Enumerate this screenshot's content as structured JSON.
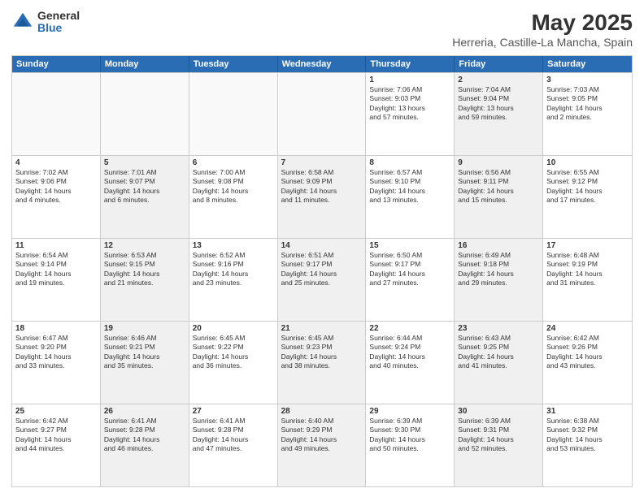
{
  "logo": {
    "general": "General",
    "blue": "Blue"
  },
  "title": "May 2025",
  "subtitle": "Herreria, Castille-La Mancha, Spain",
  "header": {
    "days": [
      "Sunday",
      "Monday",
      "Tuesday",
      "Wednesday",
      "Thursday",
      "Friday",
      "Saturday"
    ]
  },
  "rows": [
    [
      {
        "day": "",
        "info": "",
        "shaded": true
      },
      {
        "day": "",
        "info": "",
        "shaded": true
      },
      {
        "day": "",
        "info": "",
        "shaded": true
      },
      {
        "day": "",
        "info": "",
        "shaded": true
      },
      {
        "day": "1",
        "info": "Sunrise: 7:06 AM\nSunset: 9:03 PM\nDaylight: 13 hours\nand 57 minutes.",
        "shaded": false
      },
      {
        "day": "2",
        "info": "Sunrise: 7:04 AM\nSunset: 9:04 PM\nDaylight: 13 hours\nand 59 minutes.",
        "shaded": true
      },
      {
        "day": "3",
        "info": "Sunrise: 7:03 AM\nSunset: 9:05 PM\nDaylight: 14 hours\nand 2 minutes.",
        "shaded": false
      }
    ],
    [
      {
        "day": "4",
        "info": "Sunrise: 7:02 AM\nSunset: 9:06 PM\nDaylight: 14 hours\nand 4 minutes.",
        "shaded": false
      },
      {
        "day": "5",
        "info": "Sunrise: 7:01 AM\nSunset: 9:07 PM\nDaylight: 14 hours\nand 6 minutes.",
        "shaded": true
      },
      {
        "day": "6",
        "info": "Sunrise: 7:00 AM\nSunset: 9:08 PM\nDaylight: 14 hours\nand 8 minutes.",
        "shaded": false
      },
      {
        "day": "7",
        "info": "Sunrise: 6:58 AM\nSunset: 9:09 PM\nDaylight: 14 hours\nand 11 minutes.",
        "shaded": true
      },
      {
        "day": "8",
        "info": "Sunrise: 6:57 AM\nSunset: 9:10 PM\nDaylight: 14 hours\nand 13 minutes.",
        "shaded": false
      },
      {
        "day": "9",
        "info": "Sunrise: 6:56 AM\nSunset: 9:11 PM\nDaylight: 14 hours\nand 15 minutes.",
        "shaded": true
      },
      {
        "day": "10",
        "info": "Sunrise: 6:55 AM\nSunset: 9:12 PM\nDaylight: 14 hours\nand 17 minutes.",
        "shaded": false
      }
    ],
    [
      {
        "day": "11",
        "info": "Sunrise: 6:54 AM\nSunset: 9:14 PM\nDaylight: 14 hours\nand 19 minutes.",
        "shaded": false
      },
      {
        "day": "12",
        "info": "Sunrise: 6:53 AM\nSunset: 9:15 PM\nDaylight: 14 hours\nand 21 minutes.",
        "shaded": true
      },
      {
        "day": "13",
        "info": "Sunrise: 6:52 AM\nSunset: 9:16 PM\nDaylight: 14 hours\nand 23 minutes.",
        "shaded": false
      },
      {
        "day": "14",
        "info": "Sunrise: 6:51 AM\nSunset: 9:17 PM\nDaylight: 14 hours\nand 25 minutes.",
        "shaded": true
      },
      {
        "day": "15",
        "info": "Sunrise: 6:50 AM\nSunset: 9:17 PM\nDaylight: 14 hours\nand 27 minutes.",
        "shaded": false
      },
      {
        "day": "16",
        "info": "Sunrise: 6:49 AM\nSunset: 9:18 PM\nDaylight: 14 hours\nand 29 minutes.",
        "shaded": true
      },
      {
        "day": "17",
        "info": "Sunrise: 6:48 AM\nSunset: 9:19 PM\nDaylight: 14 hours\nand 31 minutes.",
        "shaded": false
      }
    ],
    [
      {
        "day": "18",
        "info": "Sunrise: 6:47 AM\nSunset: 9:20 PM\nDaylight: 14 hours\nand 33 minutes.",
        "shaded": false
      },
      {
        "day": "19",
        "info": "Sunrise: 6:46 AM\nSunset: 9:21 PM\nDaylight: 14 hours\nand 35 minutes.",
        "shaded": true
      },
      {
        "day": "20",
        "info": "Sunrise: 6:45 AM\nSunset: 9:22 PM\nDaylight: 14 hours\nand 36 minutes.",
        "shaded": false
      },
      {
        "day": "21",
        "info": "Sunrise: 6:45 AM\nSunset: 9:23 PM\nDaylight: 14 hours\nand 38 minutes.",
        "shaded": true
      },
      {
        "day": "22",
        "info": "Sunrise: 6:44 AM\nSunset: 9:24 PM\nDaylight: 14 hours\nand 40 minutes.",
        "shaded": false
      },
      {
        "day": "23",
        "info": "Sunrise: 6:43 AM\nSunset: 9:25 PM\nDaylight: 14 hours\nand 41 minutes.",
        "shaded": true
      },
      {
        "day": "24",
        "info": "Sunrise: 6:42 AM\nSunset: 9:26 PM\nDaylight: 14 hours\nand 43 minutes.",
        "shaded": false
      }
    ],
    [
      {
        "day": "25",
        "info": "Sunrise: 6:42 AM\nSunset: 9:27 PM\nDaylight: 14 hours\nand 44 minutes.",
        "shaded": false
      },
      {
        "day": "26",
        "info": "Sunrise: 6:41 AM\nSunset: 9:28 PM\nDaylight: 14 hours\nand 46 minutes.",
        "shaded": true
      },
      {
        "day": "27",
        "info": "Sunrise: 6:41 AM\nSunset: 9:28 PM\nDaylight: 14 hours\nand 47 minutes.",
        "shaded": false
      },
      {
        "day": "28",
        "info": "Sunrise: 6:40 AM\nSunset: 9:29 PM\nDaylight: 14 hours\nand 49 minutes.",
        "shaded": true
      },
      {
        "day": "29",
        "info": "Sunrise: 6:39 AM\nSunset: 9:30 PM\nDaylight: 14 hours\nand 50 minutes.",
        "shaded": false
      },
      {
        "day": "30",
        "info": "Sunrise: 6:39 AM\nSunset: 9:31 PM\nDaylight: 14 hours\nand 52 minutes.",
        "shaded": true
      },
      {
        "day": "31",
        "info": "Sunrise: 6:38 AM\nSunset: 9:32 PM\nDaylight: 14 hours\nand 53 minutes.",
        "shaded": false
      }
    ]
  ]
}
